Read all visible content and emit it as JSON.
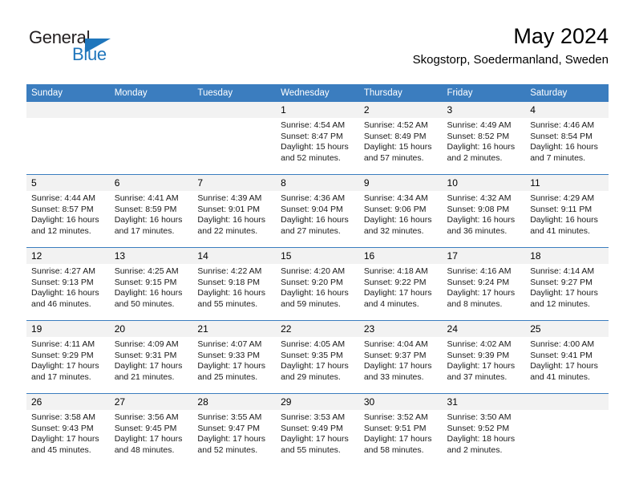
{
  "brand": {
    "name_part1": "General",
    "name_part2": "Blue",
    "triangle_icon": "blue-triangle-logo-icon",
    "accent_color": "#1f76bc"
  },
  "header": {
    "title": "May 2024",
    "subtitle": "Skogstorp, Soedermanland, Sweden"
  },
  "theme": {
    "header_row_bg": "#3b7dbf",
    "daynum_bg": "#f2f2f2",
    "grid_line": "#3b7dbf",
    "text": "#000000"
  },
  "weekday_headers": [
    "Sunday",
    "Monday",
    "Tuesday",
    "Wednesday",
    "Thursday",
    "Friday",
    "Saturday"
  ],
  "labels": {
    "sunrise_prefix": "Sunrise:",
    "sunset_prefix": "Sunset:",
    "daylight_prefix": "Daylight:"
  },
  "weeks": [
    [
      {
        "day": "",
        "empty": true
      },
      {
        "day": "",
        "empty": true
      },
      {
        "day": "",
        "empty": true
      },
      {
        "day": "1",
        "sunrise": "Sunrise: 4:54 AM",
        "sunset": "Sunset: 8:47 PM",
        "daylight": "Daylight: 15 hours and 52 minutes."
      },
      {
        "day": "2",
        "sunrise": "Sunrise: 4:52 AM",
        "sunset": "Sunset: 8:49 PM",
        "daylight": "Daylight: 15 hours and 57 minutes."
      },
      {
        "day": "3",
        "sunrise": "Sunrise: 4:49 AM",
        "sunset": "Sunset: 8:52 PM",
        "daylight": "Daylight: 16 hours and 2 minutes."
      },
      {
        "day": "4",
        "sunrise": "Sunrise: 4:46 AM",
        "sunset": "Sunset: 8:54 PM",
        "daylight": "Daylight: 16 hours and 7 minutes."
      }
    ],
    [
      {
        "day": "5",
        "sunrise": "Sunrise: 4:44 AM",
        "sunset": "Sunset: 8:57 PM",
        "daylight": "Daylight: 16 hours and 12 minutes."
      },
      {
        "day": "6",
        "sunrise": "Sunrise: 4:41 AM",
        "sunset": "Sunset: 8:59 PM",
        "daylight": "Daylight: 16 hours and 17 minutes."
      },
      {
        "day": "7",
        "sunrise": "Sunrise: 4:39 AM",
        "sunset": "Sunset: 9:01 PM",
        "daylight": "Daylight: 16 hours and 22 minutes."
      },
      {
        "day": "8",
        "sunrise": "Sunrise: 4:36 AM",
        "sunset": "Sunset: 9:04 PM",
        "daylight": "Daylight: 16 hours and 27 minutes."
      },
      {
        "day": "9",
        "sunrise": "Sunrise: 4:34 AM",
        "sunset": "Sunset: 9:06 PM",
        "daylight": "Daylight: 16 hours and 32 minutes."
      },
      {
        "day": "10",
        "sunrise": "Sunrise: 4:32 AM",
        "sunset": "Sunset: 9:08 PM",
        "daylight": "Daylight: 16 hours and 36 minutes."
      },
      {
        "day": "11",
        "sunrise": "Sunrise: 4:29 AM",
        "sunset": "Sunset: 9:11 PM",
        "daylight": "Daylight: 16 hours and 41 minutes."
      }
    ],
    [
      {
        "day": "12",
        "sunrise": "Sunrise: 4:27 AM",
        "sunset": "Sunset: 9:13 PM",
        "daylight": "Daylight: 16 hours and 46 minutes."
      },
      {
        "day": "13",
        "sunrise": "Sunrise: 4:25 AM",
        "sunset": "Sunset: 9:15 PM",
        "daylight": "Daylight: 16 hours and 50 minutes."
      },
      {
        "day": "14",
        "sunrise": "Sunrise: 4:22 AM",
        "sunset": "Sunset: 9:18 PM",
        "daylight": "Daylight: 16 hours and 55 minutes."
      },
      {
        "day": "15",
        "sunrise": "Sunrise: 4:20 AM",
        "sunset": "Sunset: 9:20 PM",
        "daylight": "Daylight: 16 hours and 59 minutes."
      },
      {
        "day": "16",
        "sunrise": "Sunrise: 4:18 AM",
        "sunset": "Sunset: 9:22 PM",
        "daylight": "Daylight: 17 hours and 4 minutes."
      },
      {
        "day": "17",
        "sunrise": "Sunrise: 4:16 AM",
        "sunset": "Sunset: 9:24 PM",
        "daylight": "Daylight: 17 hours and 8 minutes."
      },
      {
        "day": "18",
        "sunrise": "Sunrise: 4:14 AM",
        "sunset": "Sunset: 9:27 PM",
        "daylight": "Daylight: 17 hours and 12 minutes."
      }
    ],
    [
      {
        "day": "19",
        "sunrise": "Sunrise: 4:11 AM",
        "sunset": "Sunset: 9:29 PM",
        "daylight": "Daylight: 17 hours and 17 minutes."
      },
      {
        "day": "20",
        "sunrise": "Sunrise: 4:09 AM",
        "sunset": "Sunset: 9:31 PM",
        "daylight": "Daylight: 17 hours and 21 minutes."
      },
      {
        "day": "21",
        "sunrise": "Sunrise: 4:07 AM",
        "sunset": "Sunset: 9:33 PM",
        "daylight": "Daylight: 17 hours and 25 minutes."
      },
      {
        "day": "22",
        "sunrise": "Sunrise: 4:05 AM",
        "sunset": "Sunset: 9:35 PM",
        "daylight": "Daylight: 17 hours and 29 minutes."
      },
      {
        "day": "23",
        "sunrise": "Sunrise: 4:04 AM",
        "sunset": "Sunset: 9:37 PM",
        "daylight": "Daylight: 17 hours and 33 minutes."
      },
      {
        "day": "24",
        "sunrise": "Sunrise: 4:02 AM",
        "sunset": "Sunset: 9:39 PM",
        "daylight": "Daylight: 17 hours and 37 minutes."
      },
      {
        "day": "25",
        "sunrise": "Sunrise: 4:00 AM",
        "sunset": "Sunset: 9:41 PM",
        "daylight": "Daylight: 17 hours and 41 minutes."
      }
    ],
    [
      {
        "day": "26",
        "sunrise": "Sunrise: 3:58 AM",
        "sunset": "Sunset: 9:43 PM",
        "daylight": "Daylight: 17 hours and 45 minutes."
      },
      {
        "day": "27",
        "sunrise": "Sunrise: 3:56 AM",
        "sunset": "Sunset: 9:45 PM",
        "daylight": "Daylight: 17 hours and 48 minutes."
      },
      {
        "day": "28",
        "sunrise": "Sunrise: 3:55 AM",
        "sunset": "Sunset: 9:47 PM",
        "daylight": "Daylight: 17 hours and 52 minutes."
      },
      {
        "day": "29",
        "sunrise": "Sunrise: 3:53 AM",
        "sunset": "Sunset: 9:49 PM",
        "daylight": "Daylight: 17 hours and 55 minutes."
      },
      {
        "day": "30",
        "sunrise": "Sunrise: 3:52 AM",
        "sunset": "Sunset: 9:51 PM",
        "daylight": "Daylight: 17 hours and 58 minutes."
      },
      {
        "day": "31",
        "sunrise": "Sunrise: 3:50 AM",
        "sunset": "Sunset: 9:52 PM",
        "daylight": "Daylight: 18 hours and 2 minutes."
      },
      {
        "day": "",
        "empty": true
      }
    ]
  ]
}
